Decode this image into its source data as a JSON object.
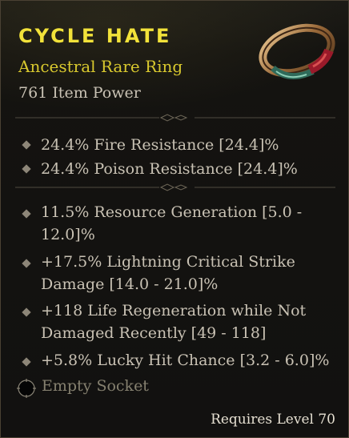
{
  "item": {
    "name": "CYCLE HATE",
    "type": "Ancestral Rare Ring",
    "power": "761 Item Power"
  },
  "implicit_stats": [
    "24.4% Fire Resistance [24.4]%",
    "24.4% Poison Resistance [24.4]%"
  ],
  "affixes": [
    {
      "line1": "11.5% Resource Generation [5.0 -",
      "line2": "12.0]%"
    },
    {
      "line1": "+17.5% Lightning Critical Strike",
      "line2": "Damage [14.0 - 21.0]%"
    },
    {
      "line1": "+118 Life Regeneration while Not",
      "line2": "Damaged Recently [49 - 118]"
    },
    {
      "line1": "+5.8% Lucky Hit Chance [3.2 - 6.0]%",
      "line2": ""
    }
  ],
  "socket": {
    "label": "Empty Socket"
  },
  "requirement": "Requires Level 70",
  "colors": {
    "title": "#f2e23a",
    "rarity": "#d8c82e",
    "stat_text": "#c9c2b4"
  }
}
